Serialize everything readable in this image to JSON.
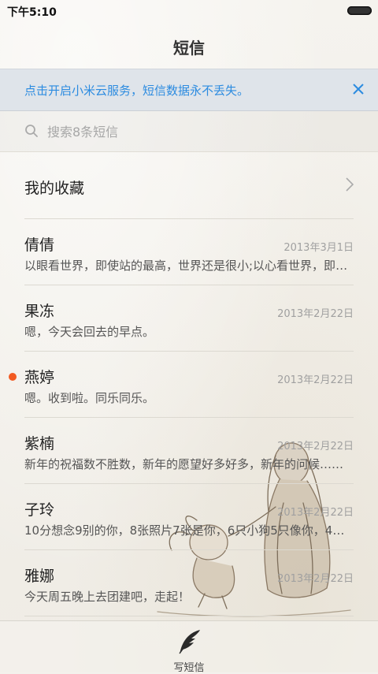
{
  "status_bar": {
    "time": "下午5:10"
  },
  "header": {
    "title": "短信"
  },
  "banner": {
    "text": "点击开启小米云服务，短信数据永不丢失。"
  },
  "search": {
    "placeholder": "搜索8条短信"
  },
  "favorites": {
    "label": "我的收藏"
  },
  "conversations": [
    {
      "name": "倩倩",
      "date": "2013年3月1日",
      "preview": "以眼看世界，即使站的最高，世界还是很小;以心看世界，即使站的最低，世界也是无穷大",
      "unread": false
    },
    {
      "name": "果冻",
      "date": "2013年2月22日",
      "preview": "嗯，今天会回去的早点。",
      "unread": false
    },
    {
      "name": "燕婷",
      "date": "2013年2月22日",
      "preview": "嗯。收到啦。同乐同乐。",
      "unread": true
    },
    {
      "name": "紫楠",
      "date": "2013年2月22日",
      "preview": "新年的祝福数不胜数，新年的愿望好多好多，新年的问候……",
      "unread": false
    },
    {
      "name": "子玲",
      "date": "2013年2月22日",
      "preview": "10分想念9别的你，8张照片7张是你，6只小狗5只像你，4……",
      "unread": false
    },
    {
      "name": "雅娜",
      "date": "2013年2月22日",
      "preview": "今天周五晚上去团建吧，走起！",
      "unread": false
    }
  ],
  "bottom_bar": {
    "compose_label": "写短信"
  },
  "colors": {
    "accent": "#2c8be0",
    "unread": "#f25a22",
    "banner_bg": "#dfe4ea"
  },
  "icons": [
    "search-icon",
    "close-icon",
    "chevron-right-icon",
    "quill-icon",
    "battery-icon"
  ]
}
